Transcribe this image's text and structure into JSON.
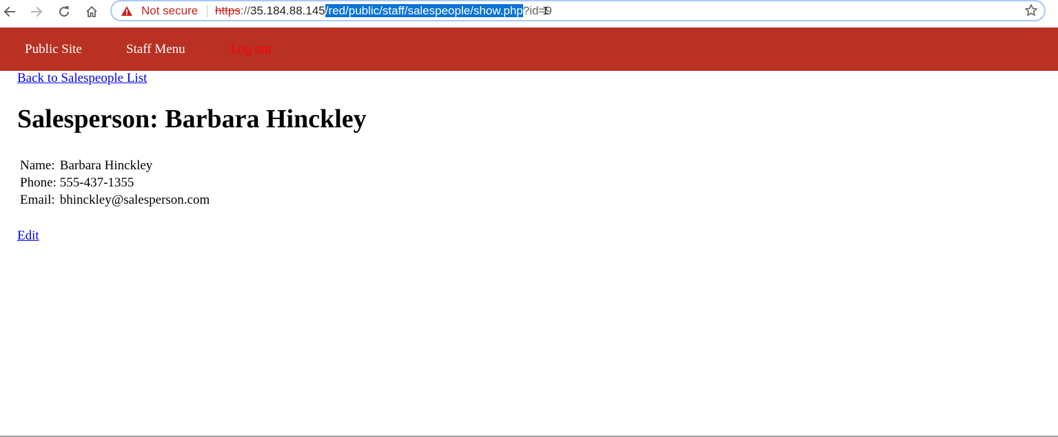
{
  "browser": {
    "security_label": "Not secure",
    "url": {
      "scheme": "https",
      "separator": "://",
      "host": "35.184.88.145",
      "path": "/red/public/staff/salespeople/show.php",
      "query": "?id=9"
    },
    "icons": [
      "back-arrow-icon",
      "forward-arrow-icon",
      "reload-icon",
      "home-icon",
      "warning-triangle-icon",
      "star-icon"
    ]
  },
  "header": {
    "nav": {
      "public_site": "Public Site",
      "staff_menu": "Staff Menu",
      "log_out": "Log out"
    },
    "colors": {
      "background": "#b93123",
      "link": "#ffffff",
      "logout_link": "#ff0000"
    }
  },
  "main": {
    "back_link": "Back to Salespeople List",
    "title": "Salesperson: Barbara Hinckley",
    "details": [
      {
        "label": "Name:",
        "value": "Barbara Hinckley"
      },
      {
        "label": "Phone:",
        "value": "555-437-1355"
      },
      {
        "label": "Email:",
        "value": "bhinckley@salesperson.com"
      }
    ],
    "edit_link": "Edit"
  }
}
